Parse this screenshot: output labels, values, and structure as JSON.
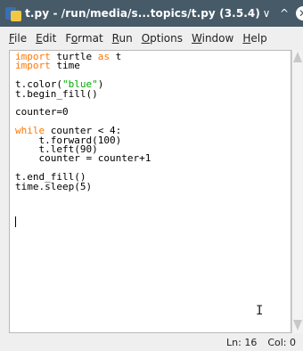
{
  "window": {
    "title": "t.py - /run/media/s...topics/t.py (3.5.4)",
    "pin_symbol": "✱",
    "buttons": {
      "minimize": "∨",
      "maximize": "^",
      "close": "✕"
    }
  },
  "menu": {
    "items": [
      {
        "label": "File",
        "mnemonic": "F"
      },
      {
        "label": "Edit",
        "mnemonic": "E"
      },
      {
        "label": "Format",
        "mnemonic": "o"
      },
      {
        "label": "Run",
        "mnemonic": "R"
      },
      {
        "label": "Options",
        "mnemonic": "O"
      },
      {
        "label": "Window",
        "mnemonic": "W"
      },
      {
        "label": "Help",
        "mnemonic": "H"
      }
    ]
  },
  "editor": {
    "lines": [
      "import turtle as t",
      "import time",
      "",
      "t.color(\"blue\")",
      "t.begin_fill()",
      "",
      "counter=0",
      "",
      "while counter < 4:",
      "    t.forward(100)",
      "    t.left(90)",
      "    counter = counter+1",
      "",
      "t.end_fill()",
      "time.sleep(5)",
      ""
    ],
    "keywords": [
      "import",
      "as",
      "while"
    ],
    "colors": {
      "keyword": "#ff7700",
      "string": "#00aa00",
      "text": "#000000"
    }
  },
  "status": {
    "line": "Ln: 16",
    "col": "Col: 0"
  },
  "colors": {
    "titlebar": "#465a68",
    "background": "#efefef",
    "editor_bg": "#ffffff"
  }
}
